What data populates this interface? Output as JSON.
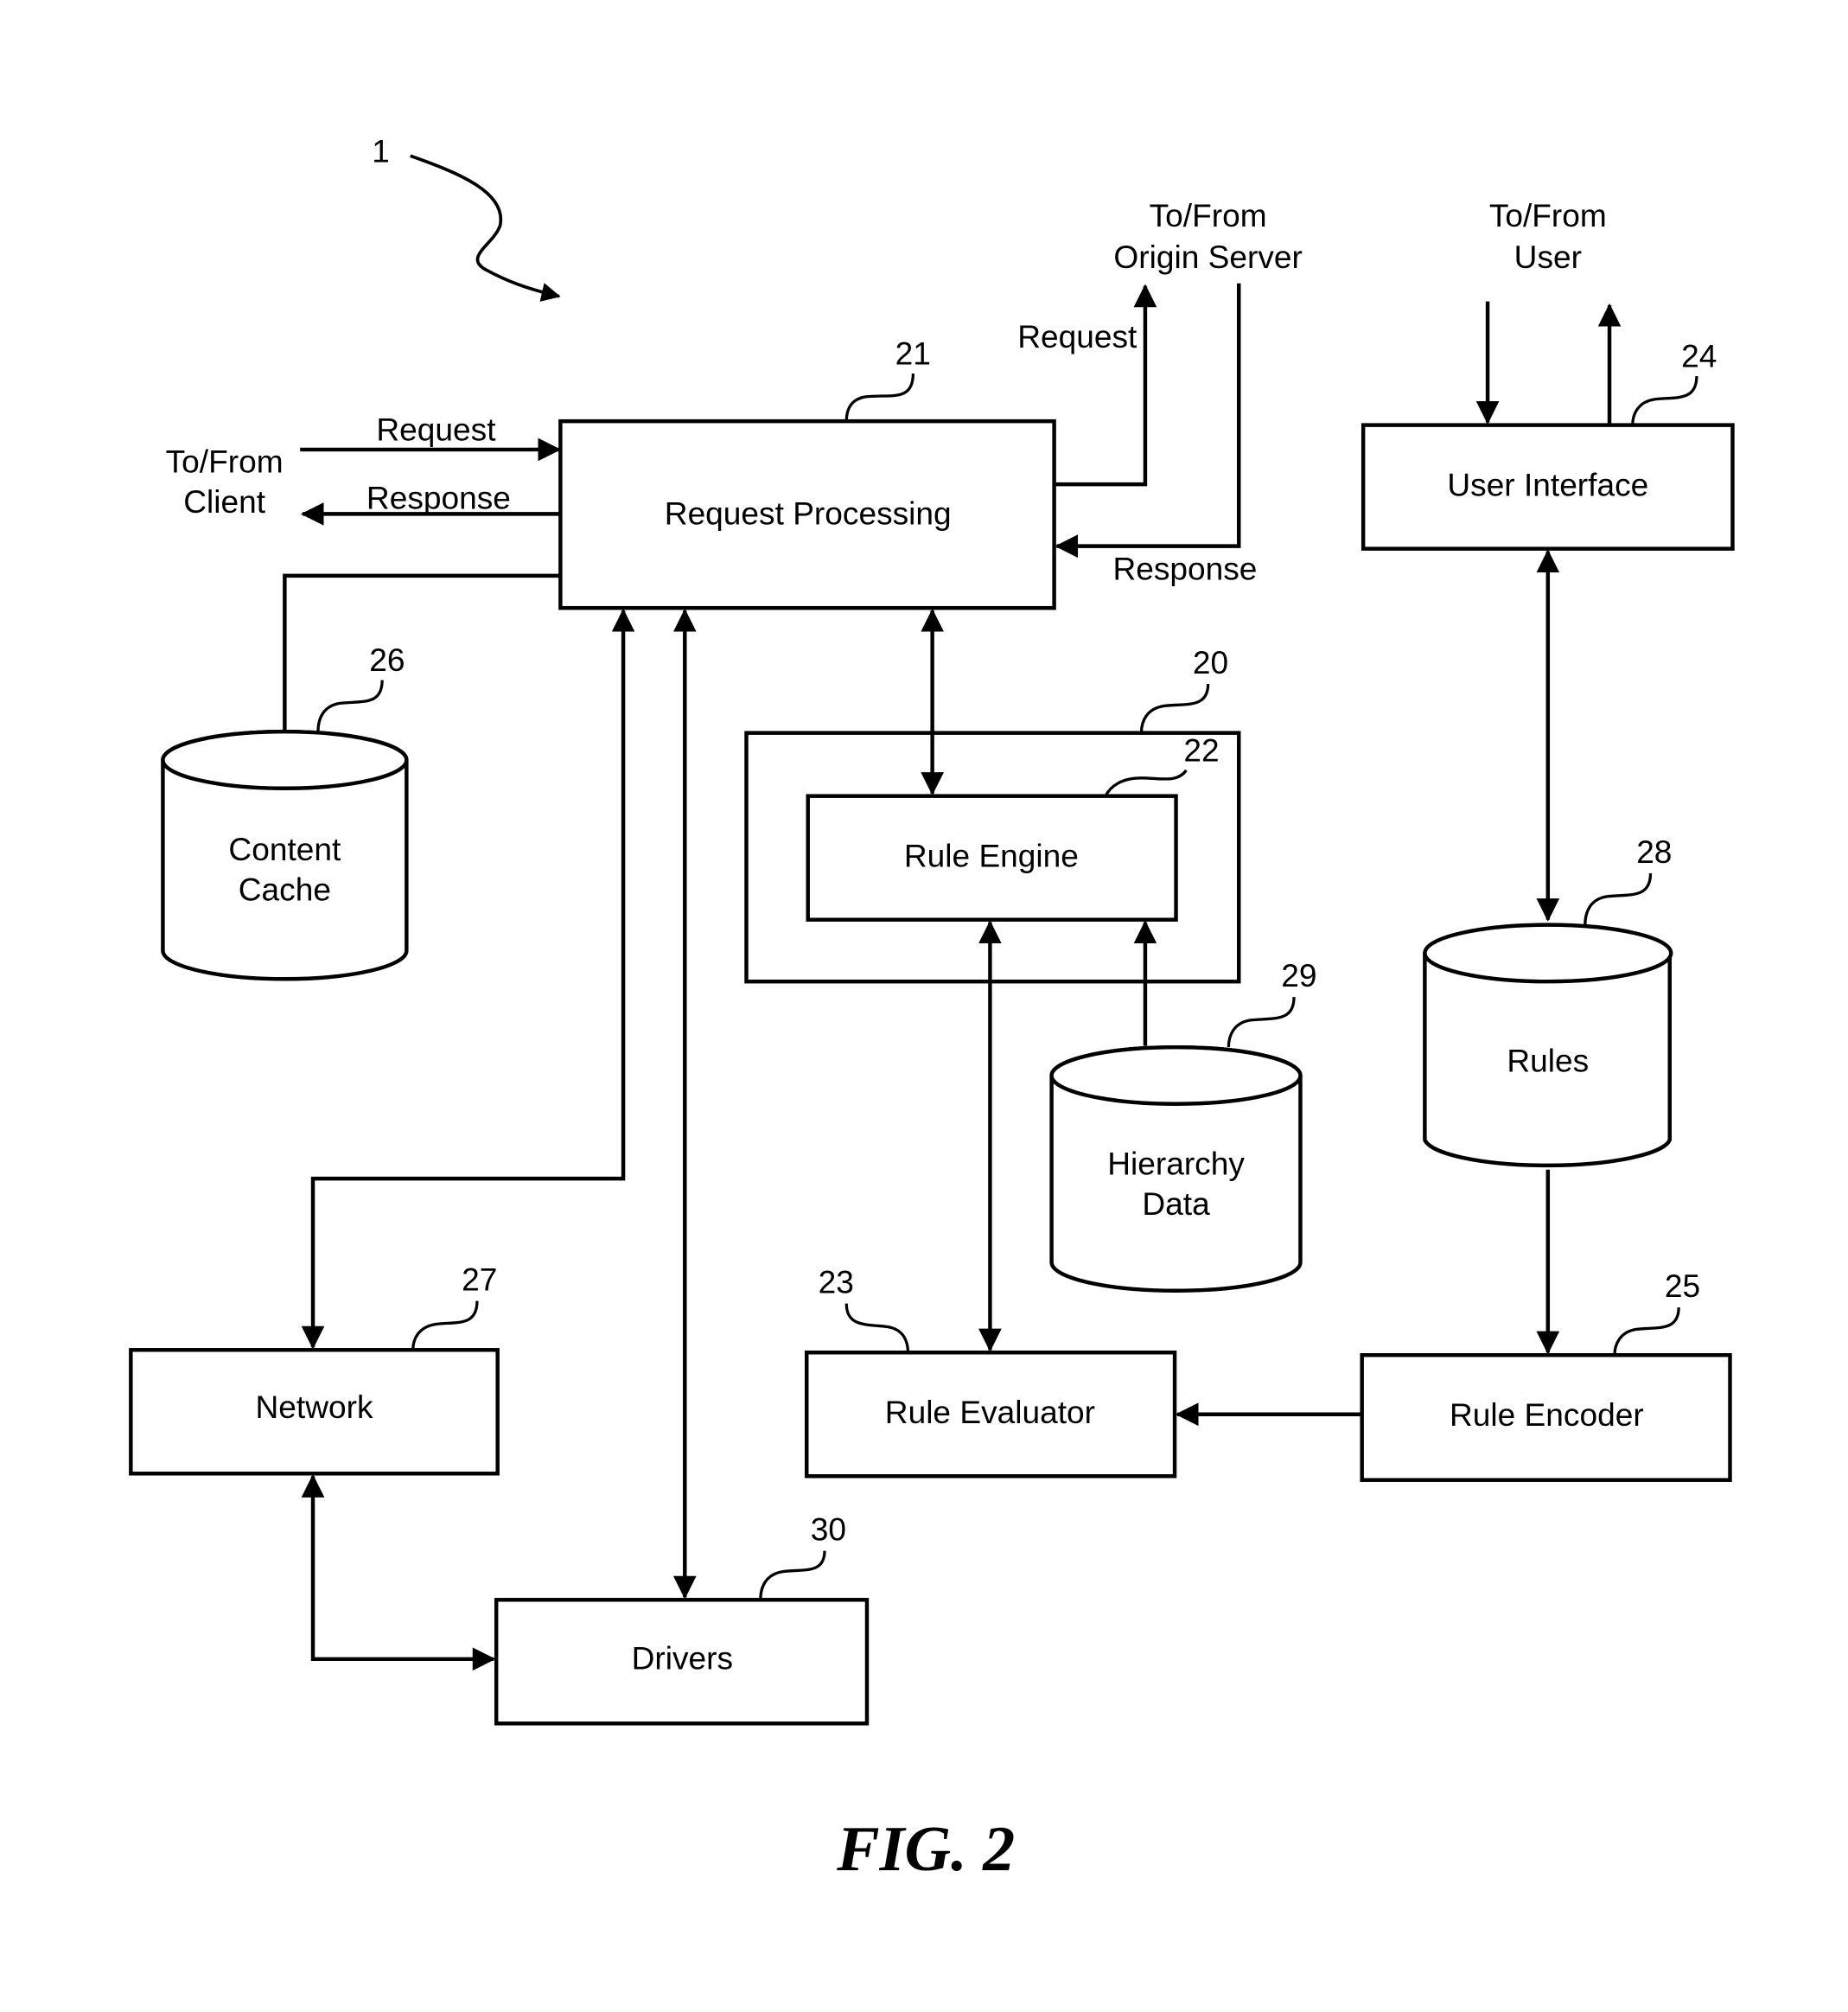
{
  "figure": {
    "caption": "FIG. 2",
    "system_ref": "1"
  },
  "nodes": {
    "request_processing": {
      "label": "Request Processing",
      "ref": "21",
      "shape": "box"
    },
    "rule_engine_group": {
      "ref": "20",
      "shape": "box"
    },
    "rule_engine": {
      "label": "Rule Engine",
      "ref": "22",
      "shape": "box"
    },
    "rule_evaluator": {
      "label": "Rule Evaluator",
      "ref": "23",
      "shape": "box"
    },
    "user_interface": {
      "label": "User Interface",
      "ref": "24",
      "shape": "box"
    },
    "rule_encoder": {
      "label": "Rule Encoder",
      "ref": "25",
      "shape": "box"
    },
    "content_cache": {
      "label_line1": "Content",
      "label_line2": "Cache",
      "ref": "26",
      "shape": "cylinder"
    },
    "network": {
      "label": "Network",
      "ref": "27",
      "shape": "box"
    },
    "rules": {
      "label": "Rules",
      "ref": "28",
      "shape": "cylinder"
    },
    "hierarchy_data": {
      "label_line1": "Hierarchy",
      "label_line2": "Data",
      "ref": "29",
      "shape": "cylinder"
    },
    "drivers": {
      "label": "Drivers",
      "ref": "30",
      "shape": "box"
    }
  },
  "external": {
    "client": {
      "line1": "To/From",
      "line2": "Client"
    },
    "origin_server": {
      "line1": "To/From",
      "line2": "Origin Server"
    },
    "user": {
      "line1": "To/From",
      "line2": "User"
    }
  },
  "edge_labels": {
    "client_request": "Request",
    "client_response": "Response",
    "origin_request": "Request",
    "origin_response": "Response"
  },
  "edges": [
    {
      "from": "client",
      "to": "request_processing",
      "label": "Request"
    },
    {
      "from": "request_processing",
      "to": "client",
      "label": "Response"
    },
    {
      "from": "request_processing",
      "to": "origin_server",
      "label": "Request"
    },
    {
      "from": "origin_server",
      "to": "request_processing",
      "label": "Response"
    },
    {
      "from": "request_processing",
      "to": "content_cache",
      "direction": "none"
    },
    {
      "from": "request_processing",
      "to": "rule_engine",
      "direction": "both"
    },
    {
      "from": "network",
      "to": "request_processing",
      "direction": "both"
    },
    {
      "from": "drivers",
      "to": "request_processing",
      "direction": "both"
    },
    {
      "from": "network",
      "to": "drivers",
      "direction": "both"
    },
    {
      "from": "rule_engine",
      "to": "rule_evaluator",
      "direction": "both"
    },
    {
      "from": "hierarchy_data",
      "to": "rule_engine",
      "direction": "forward"
    },
    {
      "from": "user",
      "to": "user_interface",
      "direction": "forward"
    },
    {
      "from": "user_interface",
      "to": "user",
      "direction": "forward"
    },
    {
      "from": "user_interface",
      "to": "rules",
      "direction": "both"
    },
    {
      "from": "rules",
      "to": "rule_encoder",
      "direction": "forward"
    },
    {
      "from": "rule_encoder",
      "to": "rule_evaluator",
      "direction": "forward"
    }
  ]
}
